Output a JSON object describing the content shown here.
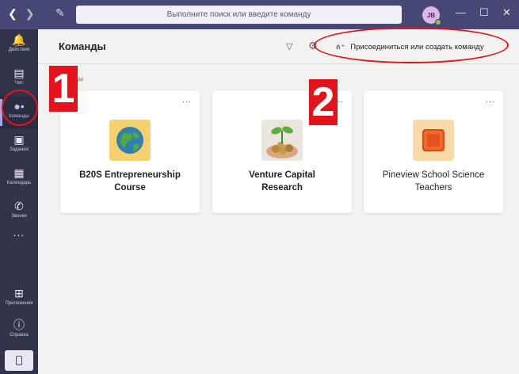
{
  "titlebar": {
    "back_icon": "chevron-left-icon",
    "forward_icon": "chevron-right-icon",
    "compose_icon": "compose-icon",
    "search_placeholder": "Выполните поиск или введите команду",
    "avatar_initials": "JB",
    "status_color": "#92c353",
    "minimize_icon": "minimize-icon",
    "maximize_icon": "maximize-icon",
    "close_icon": "close-icon"
  },
  "rail": {
    "items": [
      {
        "label": "Действия",
        "icon": "bell-icon"
      },
      {
        "label": "Чат",
        "icon": "chat-icon"
      },
      {
        "label": "Команды",
        "icon": "teams-icon",
        "active": true
      },
      {
        "label": "Задания",
        "icon": "assignments-icon"
      },
      {
        "label": "Календарь",
        "icon": "calendar-icon"
      },
      {
        "label": "Звонки",
        "icon": "phone-icon"
      }
    ],
    "more_label": "...",
    "bottom_items": [
      {
        "label": "Приложения",
        "icon": "apps-icon"
      },
      {
        "label": "Справка",
        "icon": "help-icon"
      }
    ],
    "device_icon": "mobile-device-icon"
  },
  "header": {
    "title": "Команды",
    "filter_icon": "filter-icon",
    "settings_icon": "gear-icon",
    "join_label": "Присоединиться или создать команду",
    "join_icon": "add-team-icon"
  },
  "section_label": "команды",
  "cards": [
    {
      "name_line1": "B20S Entrepreneurship",
      "name_line2": "Course",
      "bold": true,
      "more": "...",
      "logo": "globe-logo"
    },
    {
      "name_line1": "Venture Capital",
      "name_line2": "Research",
      "bold": true,
      "more": "...",
      "logo": "plant-coins-logo"
    },
    {
      "name_line1": "Pineview School Science",
      "name_line2": "Teachers",
      "bold": false,
      "more": "...",
      "logo": "orange-square-logo"
    }
  ],
  "annotations": {
    "marker1": "1",
    "marker2": "2",
    "color": "#e3131b"
  },
  "colors": {
    "titlebar": "#464775",
    "rail": "#33344a",
    "background": "#f3f2f1"
  }
}
